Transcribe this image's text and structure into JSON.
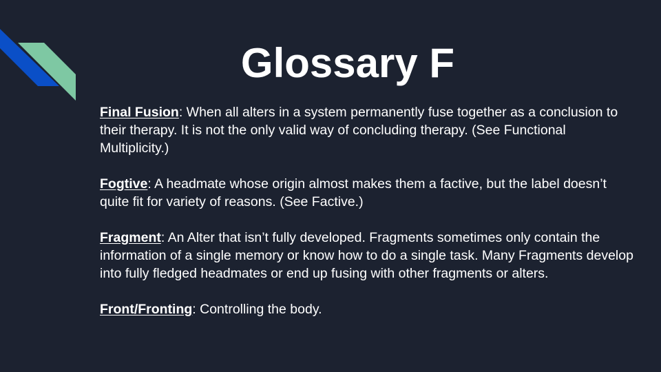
{
  "slide": {
    "title": "Glossary F",
    "colors": {
      "background": "#1c2230",
      "accent_blue": "#0a4fc7",
      "accent_green": "#7ec8a3",
      "text": "#ffffff"
    },
    "entries": [
      {
        "term": "Final Fusion",
        "definition": ": When all alters in a system permanently fuse together as a conclusion to their therapy. It is not the only valid way of concluding therapy. (See Functional Multiplicity.)"
      },
      {
        "term": "Fogtive",
        "definition": ": A headmate whose origin almost makes them a factive, but the label doesn’t quite fit for variety of reasons. (See Factive.)"
      },
      {
        "term": "Fragment",
        "definition": ": An Alter that isn’t fully developed. Fragments sometimes only contain the information of a single memory or know how to do a single task. Many Fragments develop into fully fledged headmates or end up fusing with other fragments or alters."
      },
      {
        "term": "Front/Fronting",
        "definition": ": Controlling the body."
      }
    ]
  }
}
